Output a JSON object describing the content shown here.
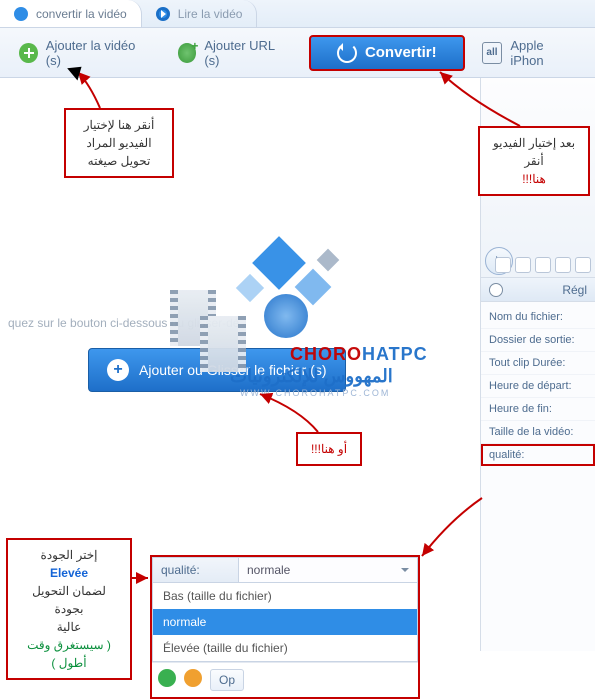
{
  "tabs": {
    "convert": "convertir la vidéo",
    "play": "Lire la vidéo"
  },
  "toolbar": {
    "add_video": "Ajouter la vidéo (s)",
    "add_url": "Ajouter URL (s)",
    "convert": "Convertir!",
    "preset": "Apple iPhon"
  },
  "main": {
    "hint": "quez sur le bouton ci-dessous ou glisser-dé",
    "add_file": "Ajouter ou Glisser le fichier (s)"
  },
  "side": {
    "panel_title": "Régl",
    "fields": [
      "Nom du fichier:",
      "Dossier de sortie:",
      "Tout clip Durée:",
      "Heure de départ:",
      "Heure de fin:",
      "Taille de la vidéo:"
    ],
    "quality_field": "qualité:"
  },
  "quality": {
    "label": "qualité:",
    "value": "normale",
    "options_low": "Bas (taille du fichier)",
    "options_normal": "normale",
    "options_high": "Élevée (taille du fichier)",
    "opt_btn": "Op"
  },
  "annotations": {
    "a1_l1": "أنقر هنا لإختيار",
    "a1_l2": "الفيديو المراد",
    "a1_l3": "تحويل صيغته",
    "a2_l1": "بعد إختيار الفيديو",
    "a2_l2": "أنقر",
    "a2_l3": "هنا!!!",
    "a3": "أو هنا!!!",
    "a4_l1": "إختر الجودة",
    "a4_l2": "Elevée",
    "a4_l3": "لضمان التحويل بجودة",
    "a4_l4": "عالية",
    "a4_l5": "( سيستغرق وقت أطول )"
  },
  "logo": {
    "t1a": "CHORO",
    "t1b": "HATPC",
    "t2": "المهووس للإلكترونيات",
    "t3": "WWW.CHOROHATPC.COM"
  }
}
